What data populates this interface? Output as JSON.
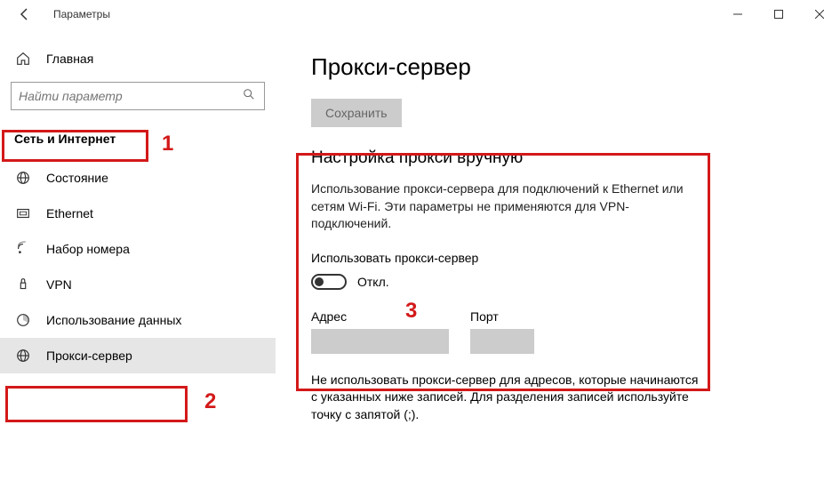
{
  "window": {
    "title": "Параметры"
  },
  "sidebar": {
    "home": "Главная",
    "search_placeholder": "Найти параметр",
    "section": "Сеть и Интернет",
    "items": [
      {
        "label": "Состояние"
      },
      {
        "label": "Ethernet"
      },
      {
        "label": "Набор номера"
      },
      {
        "label": "VPN"
      },
      {
        "label": "Использование данных"
      },
      {
        "label": "Прокси-сервер"
      }
    ]
  },
  "main": {
    "title": "Прокси-сервер",
    "save": "Сохранить",
    "manual": {
      "heading": "Настройка прокси вручную",
      "description": "Использование прокси-сервера для подключений к Ethernet или сетям Wi-Fi. Эти параметры не применяются для VPN-подключений.",
      "toggle_label": "Использовать прокси-сервер",
      "toggle_state": "Откл.",
      "address_label": "Адрес",
      "port_label": "Порт",
      "exclusion": "Не использовать прокси-сервер для адресов, которые начинаются с указанных ниже записей. Для разделения записей используйте точку с запятой (;)."
    }
  },
  "annotations": {
    "n1": "1",
    "n2": "2",
    "n3": "3"
  }
}
